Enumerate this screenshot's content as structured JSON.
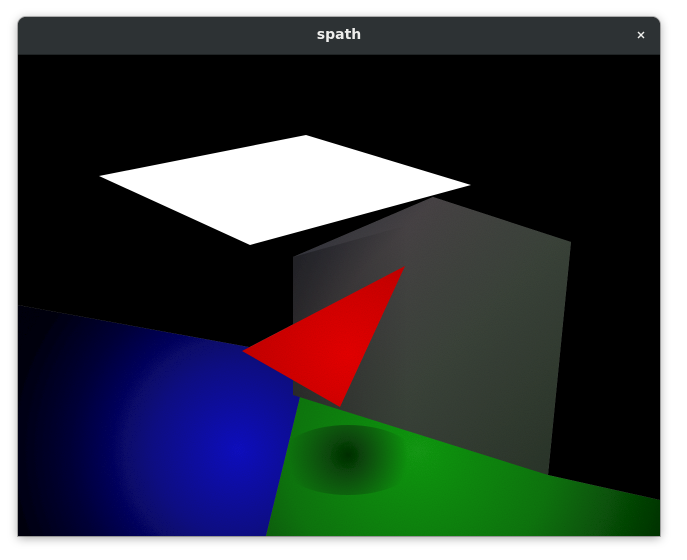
{
  "window": {
    "title": "spath",
    "close_label": "×"
  },
  "scene": {
    "description_colors": {
      "background": "#000000",
      "light_panel": "#ffffff",
      "floor_left": "#0a0a9a",
      "floor_right": "#0f8a0f",
      "wall": "#3a4238",
      "triangle": "#e00000"
    },
    "icons": {
      "close": "close-icon"
    }
  }
}
